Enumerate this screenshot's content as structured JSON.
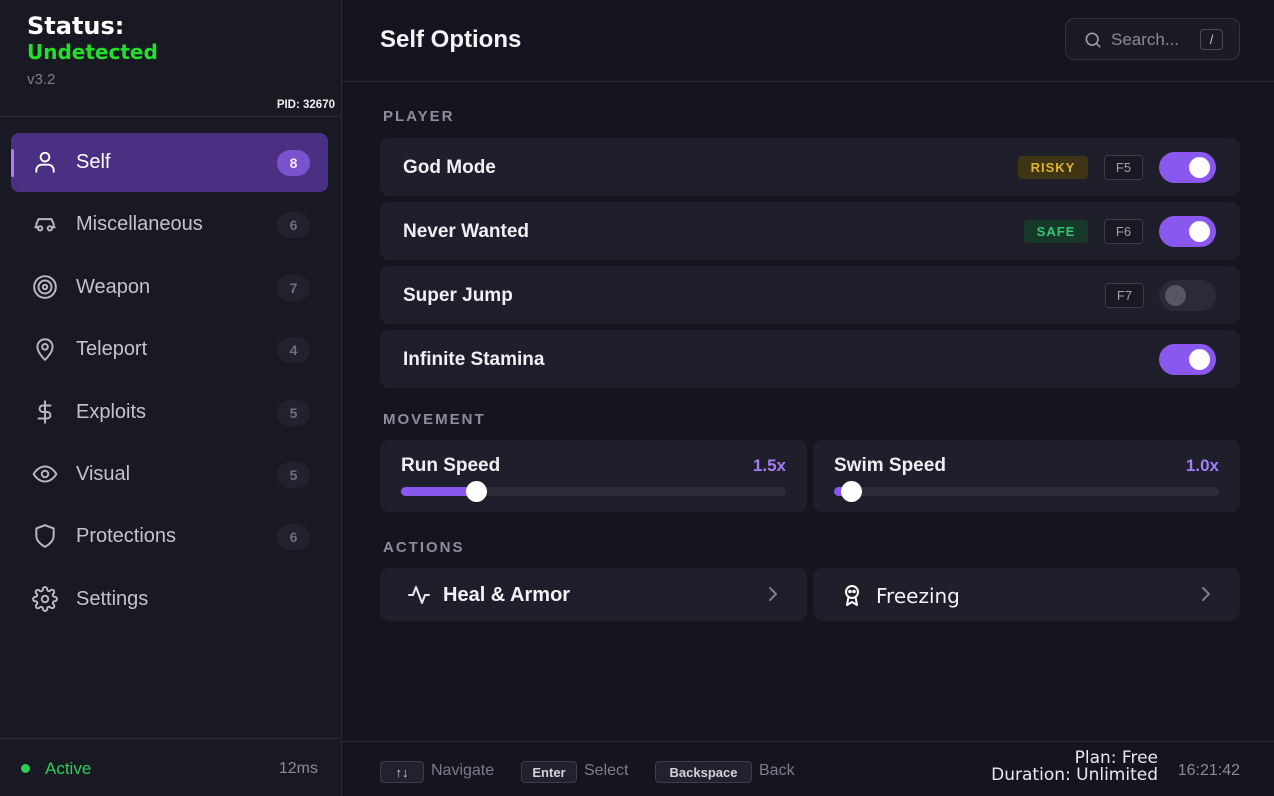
{
  "brand": {
    "status_label": "Status:",
    "status_value": "Undetected",
    "version": "v3.2",
    "pid": "PID: 32670"
  },
  "sidebar": {
    "items": [
      {
        "label": "Self",
        "count": "8",
        "icon": "user-icon",
        "active": true
      },
      {
        "label": "Miscellaneous",
        "count": "6",
        "icon": "car-icon"
      },
      {
        "label": "Weapon",
        "count": "7",
        "icon": "target-icon"
      },
      {
        "label": "Teleport",
        "count": "4",
        "icon": "map-pin-icon"
      },
      {
        "label": "Exploits",
        "count": "5",
        "icon": "dollar-icon"
      },
      {
        "label": "Visual",
        "count": "5",
        "icon": "eye-icon"
      },
      {
        "label": "Protections",
        "count": "6",
        "icon": "shield-icon"
      },
      {
        "label": "Settings",
        "count": "",
        "icon": "gear-icon"
      }
    ],
    "footer": {
      "status": "Active",
      "latency": "12ms"
    }
  },
  "header": {
    "title": "Self Options",
    "search_placeholder": "Search...",
    "search_shortcut": "/"
  },
  "sections": {
    "player": "PLAYER",
    "movement": "MOVEMENT",
    "actions": "ACTIONS"
  },
  "player_rows": [
    {
      "label": "God Mode",
      "badge": "RISKY",
      "key": "F5",
      "enabled": true
    },
    {
      "label": "Never Wanted",
      "badge": "SAFE",
      "key": "F6",
      "enabled": true
    },
    {
      "label": "Super Jump",
      "badge": "",
      "key": "F7",
      "enabled": false
    },
    {
      "label": "Infinite Stamina",
      "badge": "",
      "key": "",
      "enabled": true
    }
  ],
  "sliders": [
    {
      "label": "Run Speed",
      "value": "1.5x",
      "fraction": 0.195
    },
    {
      "label": "Swim Speed",
      "value": "1.0x",
      "fraction": 0.045
    }
  ],
  "actions": [
    {
      "label": "Heal & Armor",
      "icon": "activity-icon"
    },
    {
      "label": "Freezing",
      "icon": "award-icon"
    }
  ],
  "footer": {
    "navigate_key": "↑↓",
    "navigate_label": "Navigate",
    "select_key": "Enter",
    "select_label": "Select",
    "back_key": "Backspace",
    "back_label": "Back",
    "plan": "Plan: Free",
    "duration": "Duration: Unlimited",
    "time": "16:21:42"
  },
  "colors": {
    "accent": "#8a58ef",
    "active_nav": "#4a2f82",
    "status_green": "#22e02a",
    "risky": "#e0b42a",
    "safe": "#35c572"
  }
}
